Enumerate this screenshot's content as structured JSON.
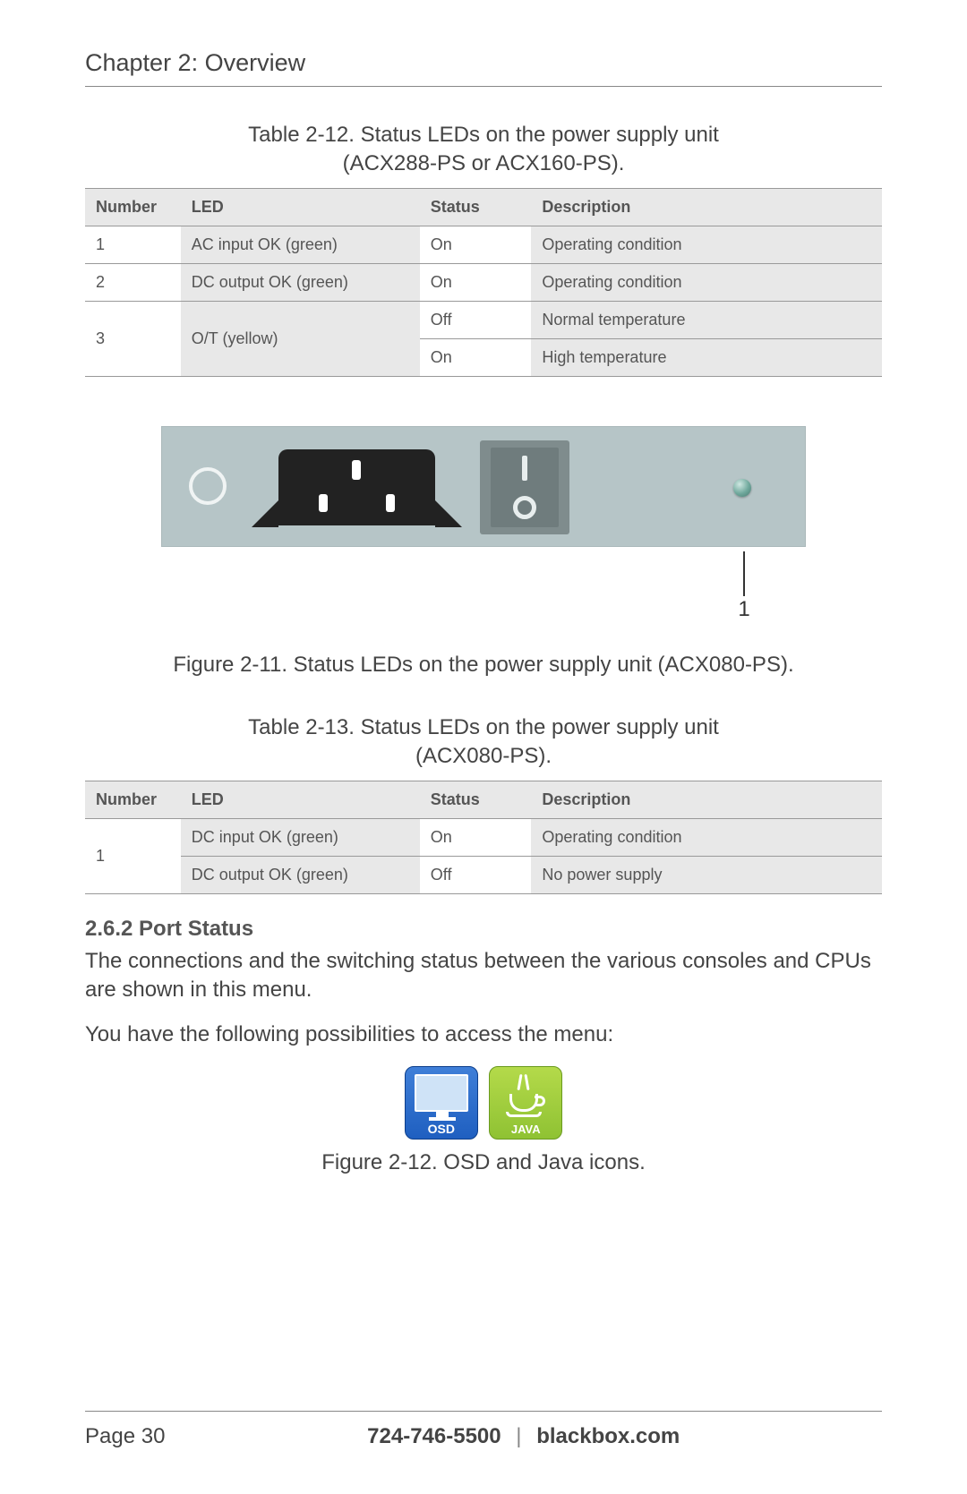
{
  "chapter_title": "Chapter 2: Overview",
  "table212": {
    "caption_l1": "Table 2-12. Status LEDs on the power supply unit",
    "caption_l2": "(ACX288-PS or ACX160-PS).",
    "headers": {
      "number": "Number",
      "led": "LED",
      "status": "Status",
      "description": "Description"
    },
    "r1": {
      "number": "1",
      "led": "AC input OK (green)",
      "status": "On",
      "description": "Operating condition"
    },
    "r2": {
      "number": "2",
      "led": "DC output OK (green)",
      "status": "On",
      "description": "Operating condition"
    },
    "r3": {
      "number": "3",
      "led": "O/T (yellow)",
      "status_a": "Off",
      "description_a": "Normal temperature",
      "status_b": "On",
      "description_b": "High temperature"
    }
  },
  "figure211": {
    "callout_number": "1",
    "caption": "Figure 2-11. Status LEDs on the power supply unit (ACX080-PS)."
  },
  "table213": {
    "caption_l1": "Table 2-13. Status LEDs on the power supply unit",
    "caption_l2": "(ACX080-PS).",
    "headers": {
      "number": "Number",
      "led": "LED",
      "status": "Status",
      "description": "Description"
    },
    "r1": {
      "number": "1",
      "led_a": "DC input OK (green)",
      "status_a": "On",
      "description_a": "Operating condition",
      "led_b": "DC output OK (green)",
      "status_b": "Off",
      "description_b": "No power supply"
    }
  },
  "section262": {
    "heading": "2.6.2 Port Status",
    "p1": "The connections and the switching status between the various consoles and CPUs are shown in this menu.",
    "p2": "You have the following possibilities to access the menu:"
  },
  "icons": {
    "osd_label": "OSD",
    "java_label": "JAVA"
  },
  "figure212": {
    "caption": "Figure 2-12. OSD and Java icons."
  },
  "footer": {
    "page_label": "Page 30",
    "phone": "724-746-5500",
    "site": "blackbox.com"
  }
}
